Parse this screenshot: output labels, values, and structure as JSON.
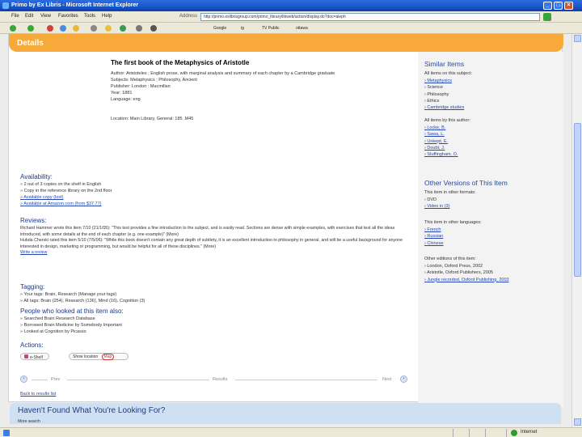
{
  "window": {
    "title": "Primo by Ex Libris - Microsoft Internet Explorer",
    "min": "_",
    "max": "□",
    "close": "×"
  },
  "menubar": {
    "items": [
      "File",
      "Edit",
      "View",
      "Favorites",
      "Tools",
      "Help"
    ],
    "address_label": "Address",
    "address_value": "http://primo.exlibrisgroup.com/primo_library/libweb/action/display.do?doc=aleph"
  },
  "toolbar": {
    "back": "Back",
    "search_label": "Google",
    "link1": "ig",
    "link2": "TV Public",
    "link3": "ottawa"
  },
  "details": {
    "header": "Details"
  },
  "record": {
    "title": "The first book of the Metaphysics of Aristotle",
    "author": "Author: Aristoteles ; English prose, with marginal analysis and summary of each chapter by a Cambridge graduate",
    "subjects": "Subjects: Metaphysics ; Philosophy, Ancient",
    "publisher": "Publisher: London : Macmillan",
    "year": "Year: 1881",
    "language": "Language: eng",
    "location": "Location: Main Library, General: 185 .M45"
  },
  "availability": {
    "heading": "Availability:",
    "items": [
      "2 out of 3 copies on the shelf in English",
      "Copy in the reference library on the 2nd floor",
      "Available copy (lost)",
      "Available at Amazon.com (from $37.77)"
    ]
  },
  "reviews": {
    "heading": "Reviews:",
    "items": [
      "Richard Hammer wrote this item 7/10 (21/1/05): \"This text provides a fine introduction to the subject, and is easily read. Sections are dense with simple examples, with exercises that test all the ideas introduced, with some details at the end of each chapter (e.g. one example)\" (More)",
      "Hubda Cherski rated this item 5/10 (7/5/06): \"While this book doesn't contain any great depth of subtlety, it is an excellent introduction to philosophy in general, and will be a useful background for anyone interested in design, marketing or programming, but would be helpful for all of these disciplines.\" (More)",
      "Write a review"
    ]
  },
  "tagging": {
    "heading": "Tagging:",
    "items": [
      "Your tags: Brain, Research (Manage your tags)",
      "All tags: Brain (254), Research (136), Mind (16), Cognition (3)"
    ]
  },
  "people": {
    "heading": "People who looked at this item also:",
    "items": [
      "Searched Brain Research Database",
      "Borrowed Brain Medicine by Somebody Important",
      "Looked at Cognition by Picasso"
    ]
  },
  "actions": {
    "heading": "Actions:",
    "eshelf": "e-Shelf",
    "show_location": "Show location",
    "show_badge": "Map"
  },
  "pager": {
    "prev": "Prev",
    "results": "Results",
    "next": "Next"
  },
  "back_link": "Back to results list",
  "similar": {
    "heading": "Similar Items",
    "subject_sub": "All items on this subject:",
    "subject_items": [
      "Metaphysics",
      "Science",
      "Philosophy",
      "Ethics",
      "Cambridge studies"
    ],
    "author_sub": "All items by this author:",
    "author_items": [
      "Locke, B.",
      "Sawa, L.",
      "Unkept, E.",
      "Doubt, J.",
      "Stuffingham, O."
    ]
  },
  "other_versions": {
    "heading": "Other Versions of This Item",
    "formats_sub": "This item in other formats:",
    "formats": [
      "DVD",
      "Video in (3)"
    ],
    "languages_sub": "This item in other languages:",
    "languages": [
      "French",
      "Russian",
      "Chinese"
    ],
    "editions_sub": "Other editions of this item:",
    "editions": [
      "London, Oxford Press, 2002",
      "Aristotle, Oxford Publishers, 2005",
      "Jungle recorded, Oxford Publishing, 2003"
    ]
  },
  "not_found": {
    "heading": "Haven't Found What You're Looking For?",
    "sub": "More search"
  },
  "status": {
    "zone": "Internet"
  }
}
